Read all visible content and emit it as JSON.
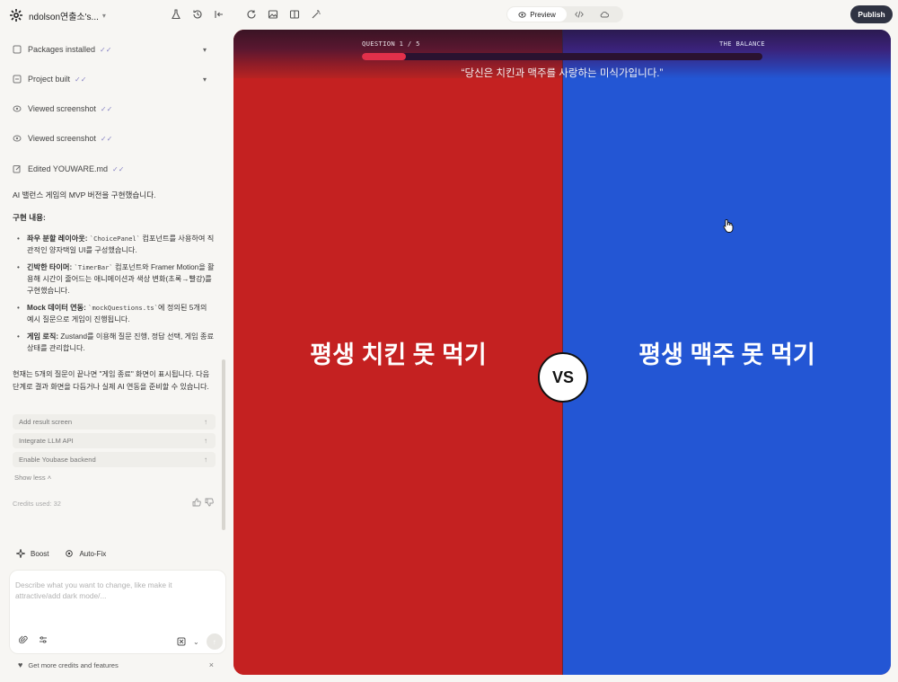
{
  "workspace": {
    "name": "ndolson연출소's..."
  },
  "activity": [
    {
      "label": "Packages installed",
      "icon": "package-icon",
      "expandable": true
    },
    {
      "label": "Project built",
      "icon": "build-icon",
      "expandable": true
    },
    {
      "label": "Viewed screenshot",
      "icon": "eye-icon",
      "expandable": false
    },
    {
      "label": "Viewed screenshot",
      "icon": "eye-icon",
      "expandable": false
    },
    {
      "label": "Edited YOUWARE.md",
      "icon": "edit-icon",
      "expandable": false
    }
  ],
  "message": {
    "intro": "AI 밸런스 게임의 MVP 버전을 구현했습니다.",
    "heading": "구현 내용:",
    "bullets": [
      {
        "title": "좌우 분할 레이아웃:",
        "code": "`ChoicePanel`",
        "rest": "컴포넌트를 사용하여 직관적인 양자택일 UI를 구성했습니다."
      },
      {
        "title": "긴박한 타이머:",
        "code": "`TimerBar`",
        "rest": "컴포넌트와 Framer Motion을 활용해 시간이 줄어드는 애니메이션과 색상 변화(초록→빨강)를 구현했습니다."
      },
      {
        "title": "Mock 데이터 연동:",
        "code": "`mockQuestions.ts`",
        "rest": "에 정의된 5개의 예시 질문으로 게임이 진행됩니다."
      },
      {
        "title": "게임 로직:",
        "code": "",
        "rest": "Zustand를 이용해 질문 진행, 정답 선택, 게임 종료 상태를 관리합니다."
      }
    ],
    "outro": "현재는 5개의 질문이 끝나면 \"게임 종료\" 화면이 표시됩니다. 다음 단계로 결과 화면을 다듬거나 실제 AI 연동을 준비할 수 있습니다."
  },
  "suggestions": [
    "Add result screen",
    "Integrate LLM API",
    "Enable Youbase backend"
  ],
  "show_less": "Show less",
  "credits": "Credits used: 32",
  "tools": {
    "boost": "Boost",
    "autofix": "Auto-Fix"
  },
  "composer": {
    "placeholder": "Describe what you want to change, like make it attractive/add dark mode/..."
  },
  "promo": "Get more credits and features",
  "topbar": {
    "preview_label": "Preview",
    "publish_label": "Publish"
  },
  "game": {
    "question_counter": "QUESTION 1 / 5",
    "brand": "THE BALANCE",
    "timer_progress": 0.11,
    "question": "“당신은 치킨과 맥주를 사랑하는 미식가입니다.”",
    "choice_a": "평생 치킨 못 먹기",
    "choice_b": "평생 맥주 못 먹기",
    "vs": "VS"
  },
  "colors": {
    "choice_a": "#c42121",
    "choice_b": "#2356d4",
    "publish": "#2f3342",
    "timer": "#e2304a"
  }
}
